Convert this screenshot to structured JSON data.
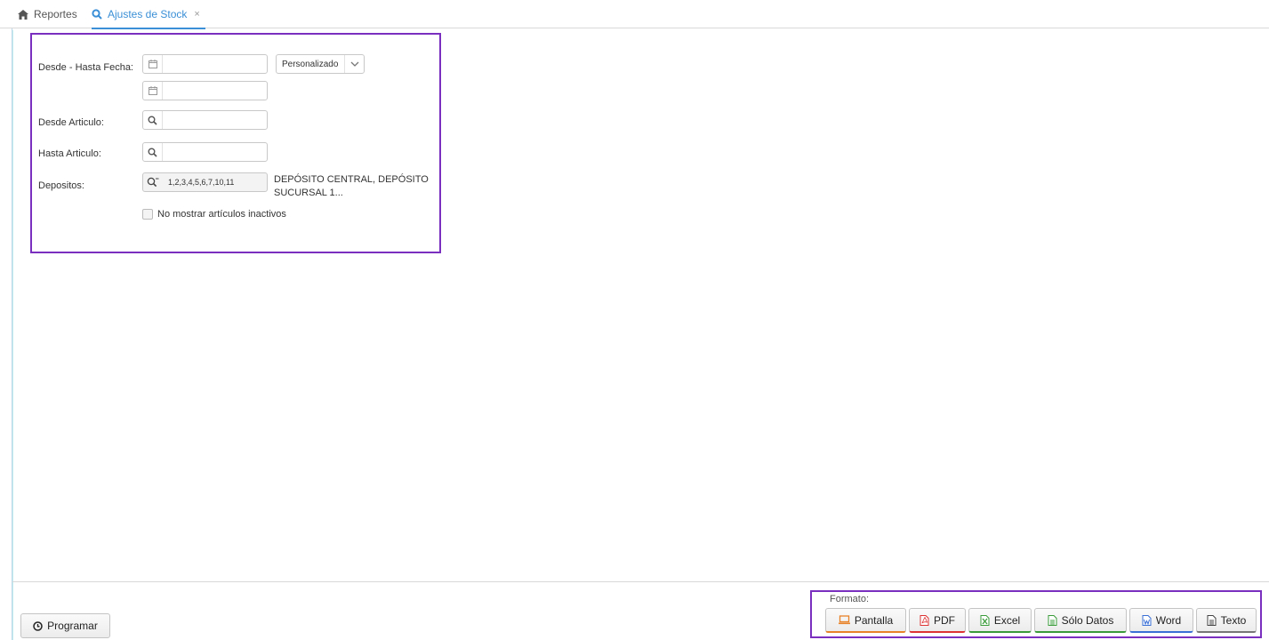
{
  "tabs": [
    {
      "label": "Reportes",
      "icon": "home-icon"
    },
    {
      "label": "Ajustes de Stock",
      "icon": "search-icon",
      "close": "×",
      "active": true
    }
  ],
  "filters": {
    "fecha_label": "Desde - Hasta Fecha:",
    "fecha_desde": "",
    "fecha_hasta": "",
    "periodo_value": "Personalizado",
    "desde_articulo_label": "Desde Articulo:",
    "desde_articulo_value": "",
    "hasta_articulo_label": "Hasta Articulo:",
    "hasta_articulo_value": "",
    "depositos_label": "Depositos:",
    "depositos_value": "1,2,3,4,5,6,7,10,11",
    "depositos_desc_line1": "DEPÓSITO CENTRAL, DEPÓSITO",
    "depositos_desc_line2": "SUCURSAL 1...",
    "inactivos_label": "No mostrar artículos inactivos",
    "inactivos_checked": false
  },
  "footer": {
    "programar_label": "Programar",
    "formato_label": "Formato:",
    "buttons": {
      "pantalla": "Pantalla",
      "pdf": "PDF",
      "excel": "Excel",
      "solo_datos": "Sólo Datos",
      "word": "Word",
      "texto": "Texto"
    }
  },
  "colors": {
    "accent": "#3a8fd6",
    "highlight_border": "#7b2fbe",
    "pantalla": "#e8832a",
    "pdf": "#d33333",
    "excel": "#3a9b3a",
    "word": "#3a6fd6"
  }
}
